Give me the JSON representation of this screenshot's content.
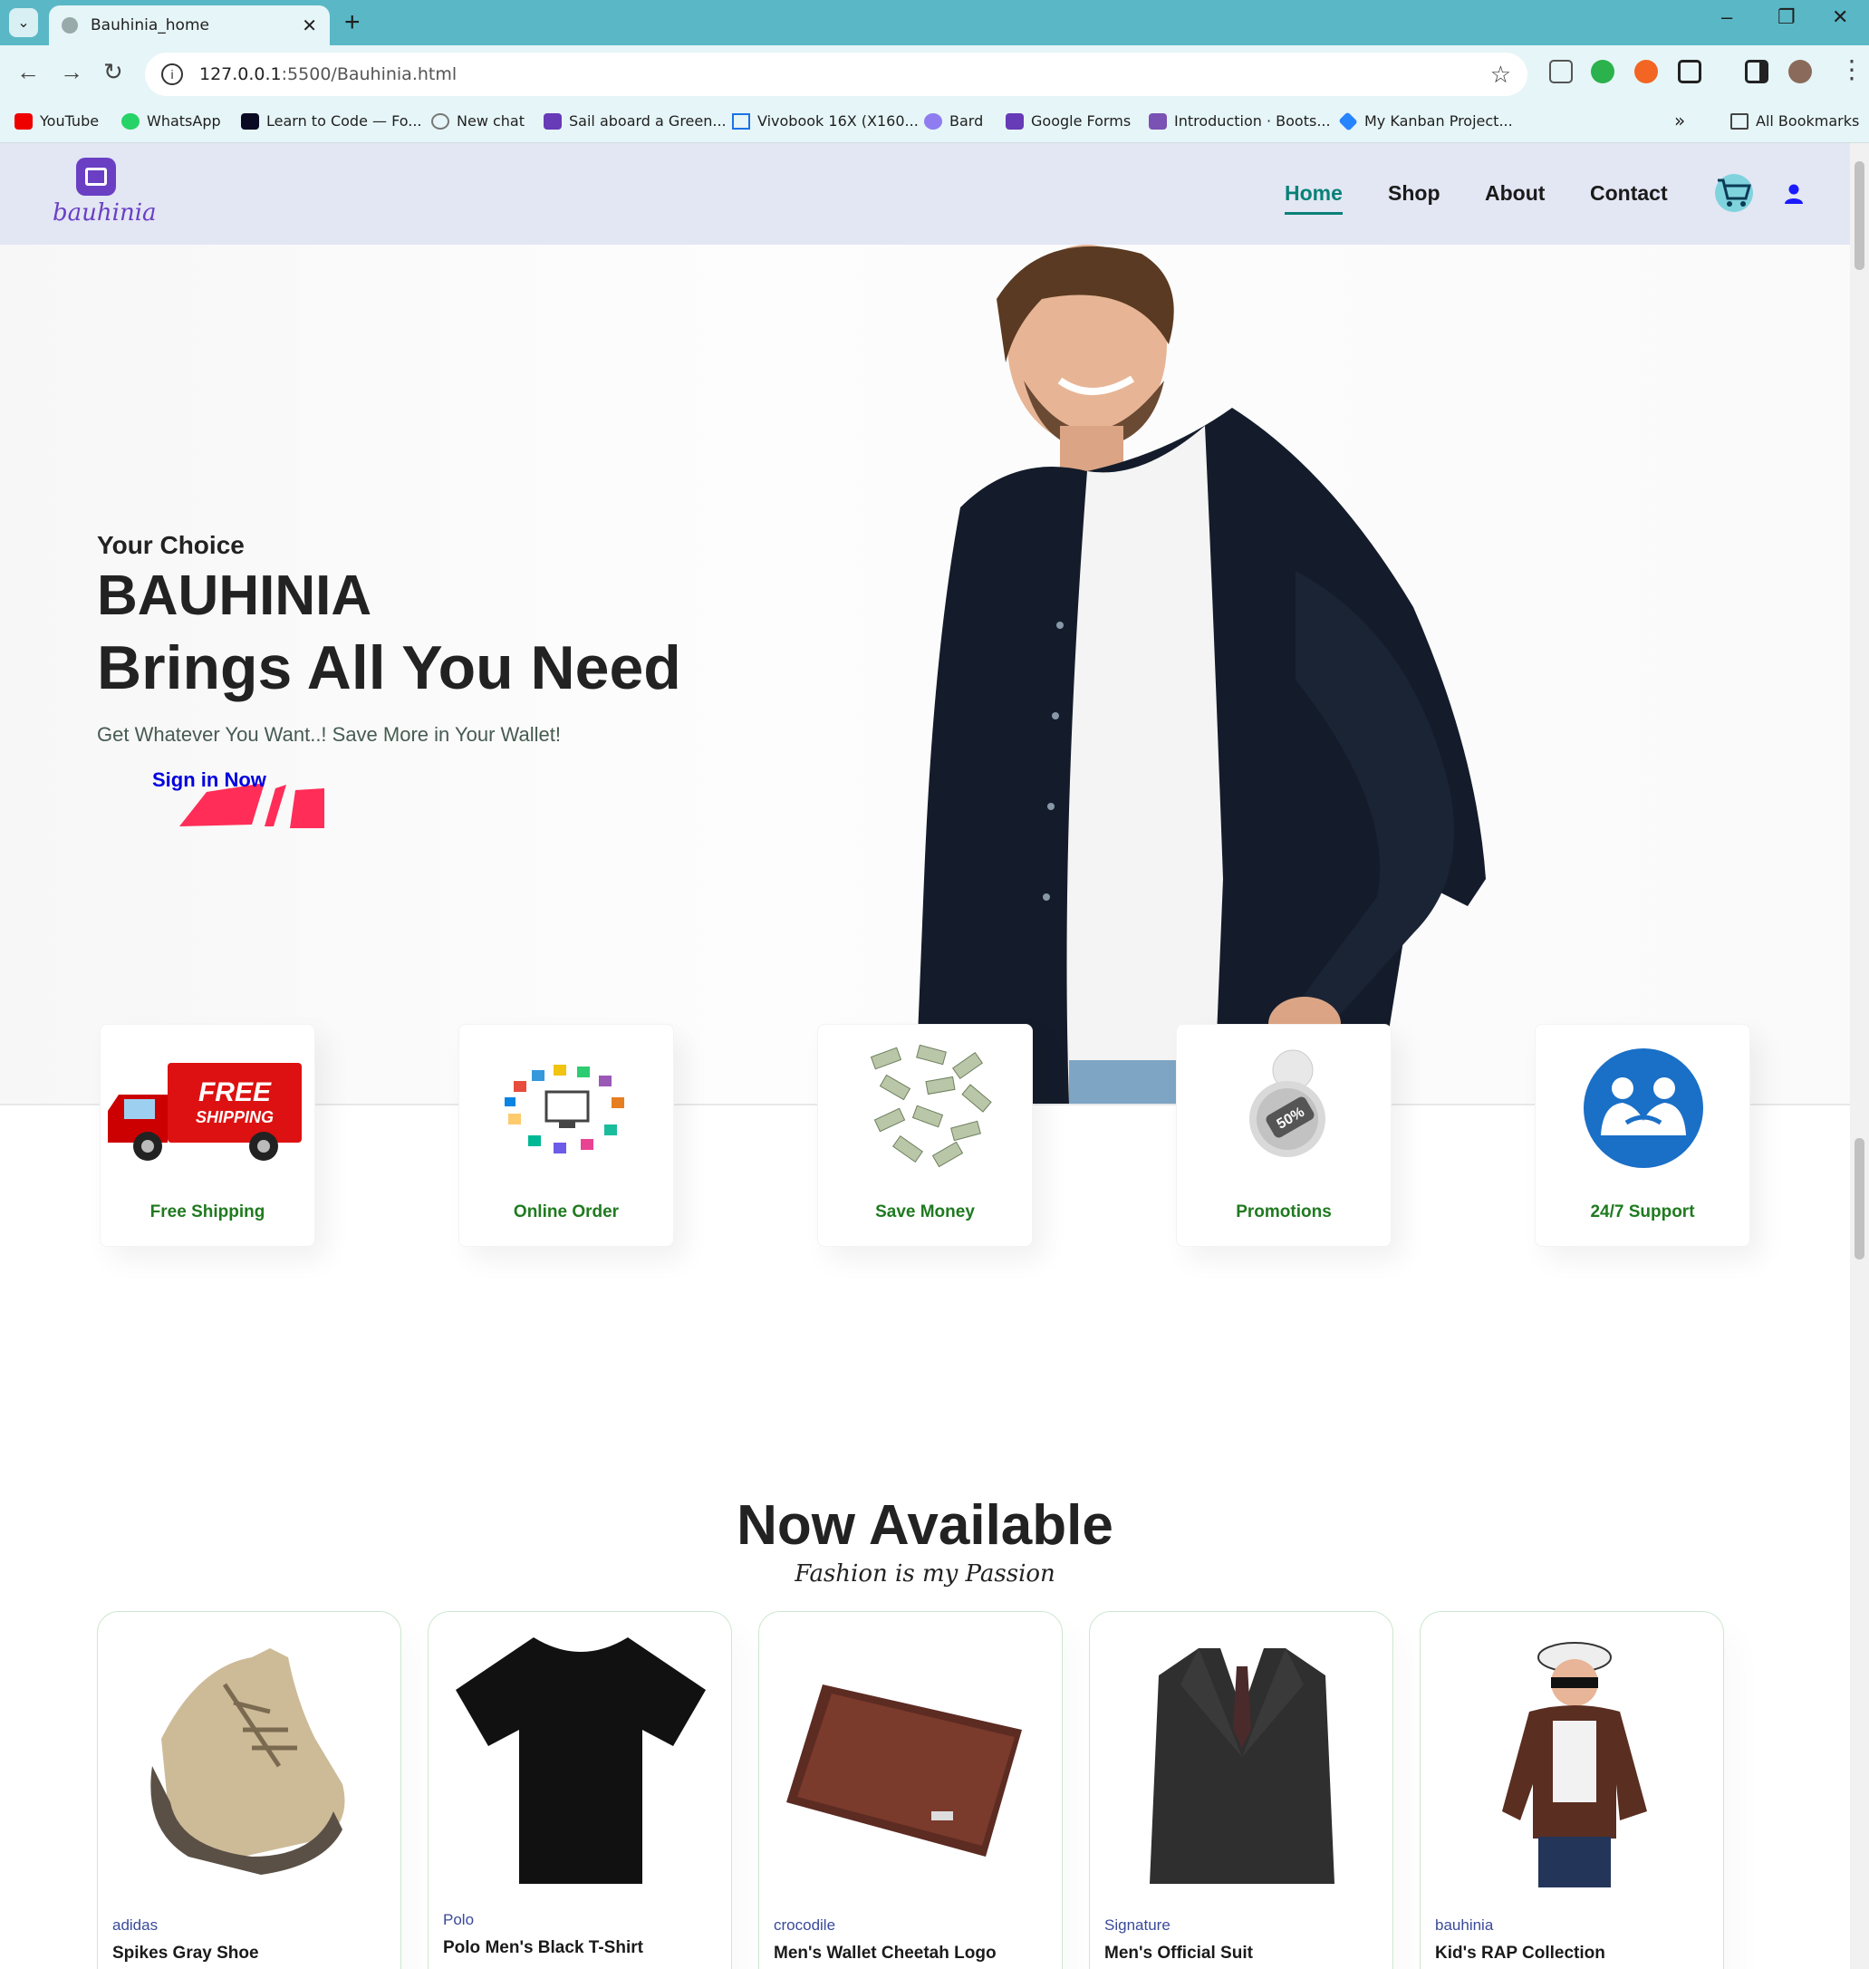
{
  "browser": {
    "tab_title": "Bauhinia_home",
    "url_host": "127.0.0.1",
    "url_path": ":5500/Bauhinia.html",
    "bookmarks": [
      "YouTube",
      "WhatsApp",
      "Learn to Code — Fo...",
      "New chat",
      "Sail aboard a Green...",
      "Vivobook 16X (X160...",
      "Bard",
      "Google Forms",
      "Introduction · Boots...",
      "My Kanban Project..."
    ],
    "more_bookmarks": "»",
    "all_bookmarks": "All Bookmarks"
  },
  "header": {
    "logo_text": "bauhinia",
    "nav": [
      "Home",
      "Shop",
      "About",
      "Contact"
    ],
    "active_nav": "Home"
  },
  "hero": {
    "subtitle": "Your Choice",
    "title": "BAUHINIA",
    "title2": "Brings All You Need",
    "description": "Get Whatever You Want..! Save More in Your Wallet!",
    "button": "Sign in Now"
  },
  "features": [
    "Free Shipping",
    "Online Order",
    "Save Money",
    "Promotions",
    "24/7 Support"
  ],
  "products_section": {
    "title": "Now Available",
    "subtitle": "Fashion is my Passion",
    "items": [
      {
        "brand": "adidas",
        "name": "Spikes Gray Shoe"
      },
      {
        "brand": "Polo",
        "name": "Polo Men's Black T-Shirt"
      },
      {
        "brand": "crocodile",
        "name": "Men's Wallet Cheetah Logo"
      },
      {
        "brand": "Signature",
        "name": "Men's Official Suit"
      },
      {
        "brand": "bauhinia",
        "name": "Kid's RAP Collection"
      }
    ]
  },
  "colors": {
    "accent": "#088178",
    "chrome": "#5ab8c6",
    "brand": "#6a3fc4",
    "feature_label": "#1f7a1f"
  }
}
